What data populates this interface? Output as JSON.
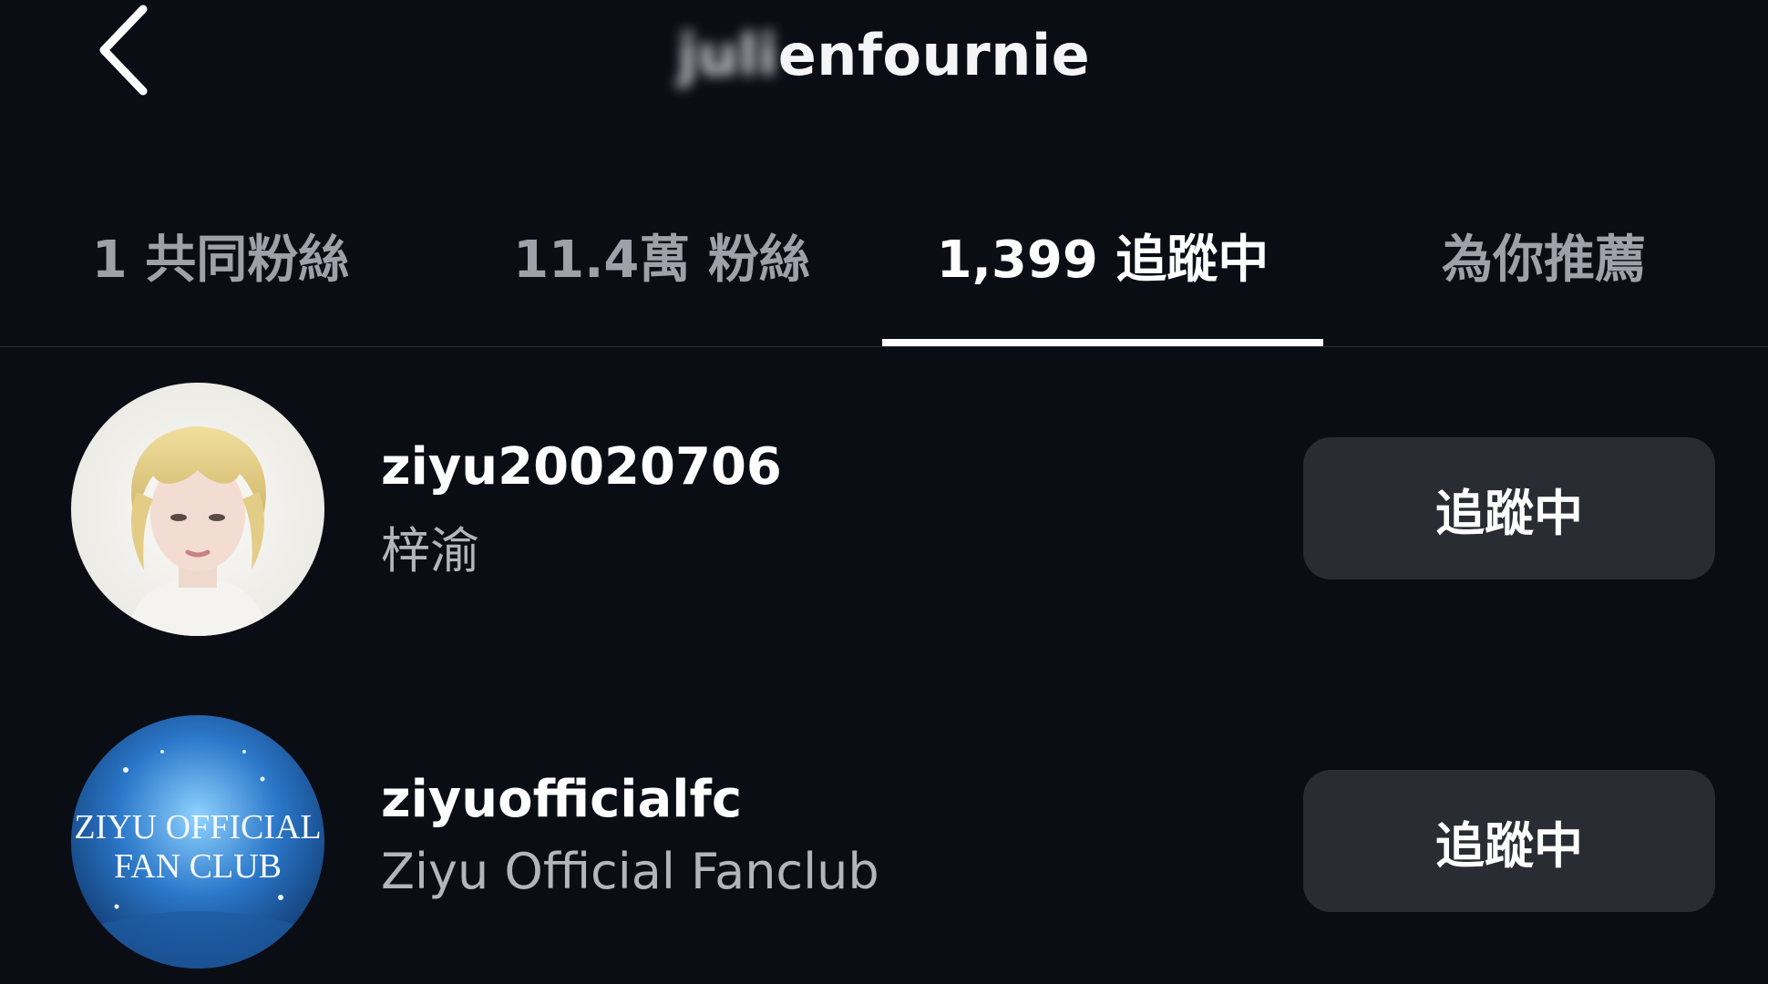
{
  "header": {
    "title_hidden": "juli",
    "title_visible": "enfournie"
  },
  "tabs": [
    {
      "label": "1 共同粉絲"
    },
    {
      "label": "11.4萬 粉絲"
    },
    {
      "label": "1,399 追蹤中",
      "active": true
    },
    {
      "label": "為你推薦"
    }
  ],
  "list": [
    {
      "username": "ziyu20020706",
      "fullname": "梓渝",
      "button": "追蹤中"
    },
    {
      "username": "ziyuofficialfc",
      "fullname": "Ziyu Official Fanclub",
      "button": "追蹤中",
      "avatar_text_1": "ZIYU OFFICIAL",
      "avatar_text_2": "FAN CLUB"
    }
  ]
}
